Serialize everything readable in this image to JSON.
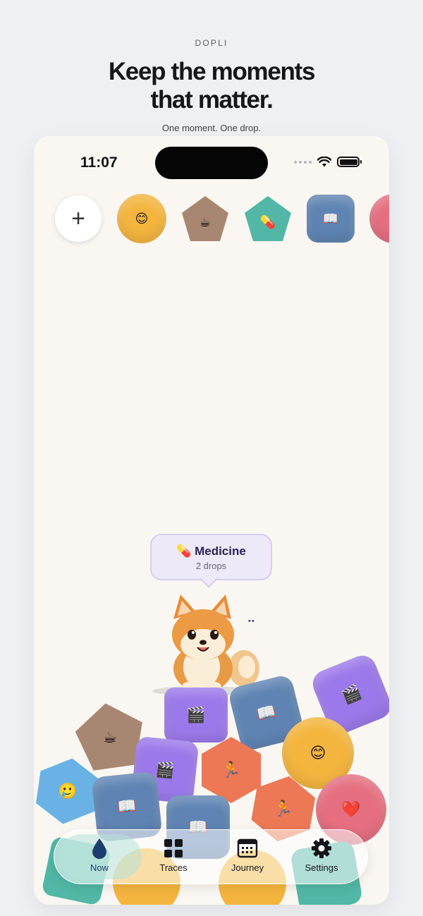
{
  "header": {
    "brand": "DOPLI",
    "headline_line1": "Keep the moments",
    "headline_line2": "that matter.",
    "tagline": "One moment. One drop."
  },
  "status_bar": {
    "time": "11:07"
  },
  "shape_picker": {
    "items": [
      {
        "name": "add",
        "label": "+"
      },
      {
        "name": "mood",
        "glyph": "😊",
        "color": "#f4b53f"
      },
      {
        "name": "coffee",
        "glyph": "☕",
        "color": "#a88772"
      },
      {
        "name": "medicine",
        "glyph": "💊",
        "color": "#52b7a6"
      },
      {
        "name": "book",
        "glyph": "📖",
        "color": "#5f84b3"
      },
      {
        "name": "heart",
        "glyph": "",
        "color": "#e56f80"
      }
    ]
  },
  "bubble": {
    "icon": "💊",
    "title": "Medicine",
    "subtitle": "2 drops"
  },
  "mascot": {
    "sleep": "••"
  },
  "drops": {
    "movie": "🎬",
    "book": "📖",
    "coffee": "☕",
    "smile": "😊",
    "teary": "🥲",
    "run": "🏃",
    "heart": "❤️"
  },
  "tabbar": {
    "tabs": [
      {
        "label": "Now",
        "active": true
      },
      {
        "label": "Traces",
        "active": false
      },
      {
        "label": "Journey",
        "active": false
      },
      {
        "label": "Settings",
        "active": false
      }
    ]
  },
  "colors": {
    "yellow": "#f4b53f",
    "brown": "#a88772",
    "teal": "#52b7a6",
    "blue": "#5f84b3",
    "pink": "#e56f80",
    "purple": "#9c79ea",
    "orange": "#ec7856",
    "sky": "#6ab2e5"
  }
}
